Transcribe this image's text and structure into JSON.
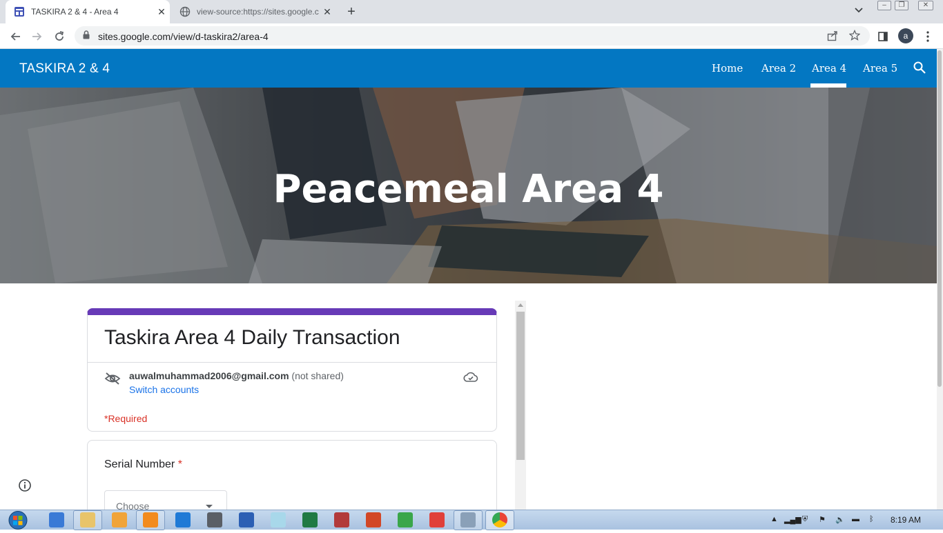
{
  "browser": {
    "tabs": [
      {
        "title": "TASKIRA 2 & 4 - Area 4",
        "active": true
      },
      {
        "title": "view-source:https://sites.google.c",
        "active": false
      }
    ],
    "url": "sites.google.com/view/d-taskira2/area-4",
    "profile_initial": "a"
  },
  "site": {
    "title": "TASKIRA 2 & 4",
    "nav": [
      "Home",
      "Area 2",
      "Area 4",
      "Area 5"
    ],
    "active_nav": "Area 4",
    "hero_title": "Peacemeal Area 4"
  },
  "form": {
    "title": "Taskira Area 4 Daily Transaction",
    "account_email": "auwalmuhammad2006@gmail.com",
    "account_status": "(not shared)",
    "switch_accounts": "Switch accounts",
    "required_note": "*Required",
    "question_label": "Serial Number",
    "required_star": "*",
    "select_placeholder": "Choose"
  },
  "taskbar": {
    "clock": "8:19 AM"
  },
  "colors": {
    "site_bar": "#0377c2",
    "form_accent": "#673ab7",
    "required": "#d93025",
    "link": "#1a73e8"
  }
}
